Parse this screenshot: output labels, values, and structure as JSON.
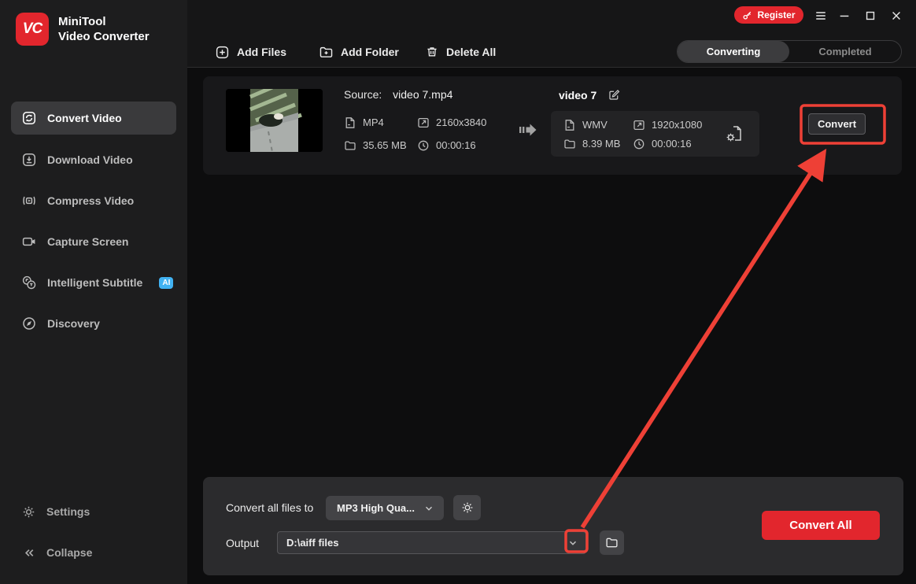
{
  "app": {
    "logo_text": "VC",
    "title_line1": "MiniTool",
    "title_line2": "Video Converter"
  },
  "titlebar": {
    "register_label": "Register"
  },
  "sidebar": {
    "items": [
      {
        "label": "Convert Video"
      },
      {
        "label": "Download Video"
      },
      {
        "label": "Compress Video"
      },
      {
        "label": "Capture Screen"
      },
      {
        "label": "Intelligent Subtitle",
        "badge": "AI"
      },
      {
        "label": "Discovery"
      }
    ],
    "footer": {
      "settings": "Settings",
      "collapse": "Collapse"
    }
  },
  "toolbar": {
    "add_files": "Add Files",
    "add_folder": "Add Folder",
    "delete_all": "Delete All"
  },
  "tabs": {
    "converting": "Converting",
    "completed": "Completed"
  },
  "task": {
    "source_label": "Source:",
    "source_name": "video 7.mp4",
    "source_format": "MP4",
    "source_resolution": "2160x3840",
    "source_size": "35.65 MB",
    "source_duration": "00:00:16",
    "target_name": "video 7",
    "target_format": "WMV",
    "target_resolution": "1920x1080",
    "target_size": "8.39 MB",
    "target_duration": "00:00:16",
    "convert_label": "Convert"
  },
  "bottom_bar": {
    "convert_all_files_to": "Convert all files to",
    "format_value": "MP3 High Qua...",
    "output_label": "Output",
    "output_path": "D:\\aiff files",
    "convert_all_label": "Convert All"
  },
  "colors": {
    "accent_red": "#e2262d",
    "annotation_red": "#ee4036",
    "ai_badge_blue": "#41b2f2",
    "sidebar_bg": "#1d1d1e",
    "panel_bg": "#2b2b2d"
  }
}
